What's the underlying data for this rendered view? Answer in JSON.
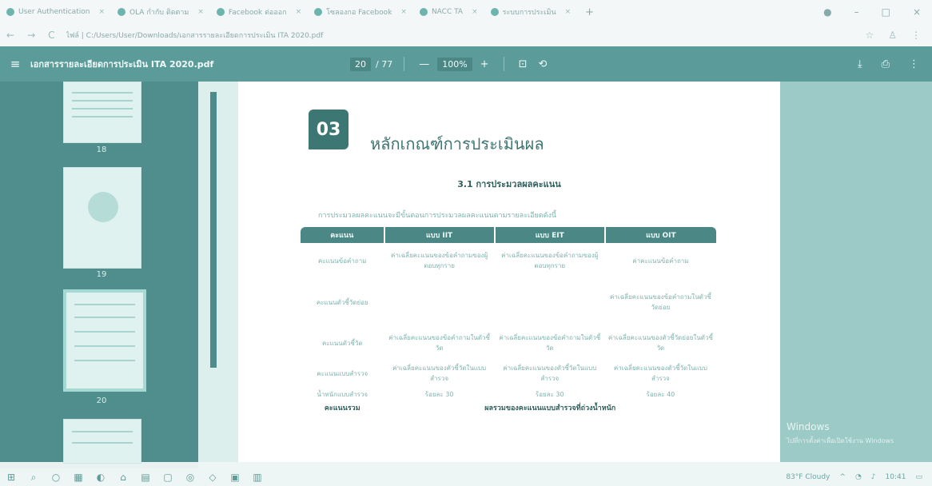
{
  "tabs": [
    {
      "label": "User Authentication"
    },
    {
      "label": "OLA กำกับ ติดตาม"
    },
    {
      "label": "Facebook ต่อออก"
    },
    {
      "label": "โซลองกอ Facebook"
    },
    {
      "label": "NACC TA"
    },
    {
      "label": "ระบบการประเมิน"
    }
  ],
  "address": {
    "url": "ไฟล์ | C:/Users/User/Downloads/เอกสารรายละเอียดการประเมิน ITA 2020.pdf"
  },
  "pdf": {
    "filename": "เอกสารรายละเอียดการประเมิน ITA 2020.pdf",
    "page": "20",
    "total": "/ 77",
    "zoom": "100%",
    "minus": "—",
    "plus": "+"
  },
  "thumbnails": [
    {
      "label": "18"
    },
    {
      "label": "19"
    },
    {
      "label": "20"
    }
  ],
  "doc": {
    "badge": "03",
    "section_title": "หลักเกณฑ์การประเมินผล",
    "subsection": "3.1 การประมวลผลคะแนน",
    "intro": "การประมวลผลคะแนนจะมีขั้นตอนการประมวลผลคะแนนตามรายละเอียดดังนี้",
    "table": {
      "headers": [
        "คะแนน",
        "แบบ IIT",
        "แบบ EIT",
        "แบบ OIT"
      ],
      "rows": [
        [
          "คะแนนข้อคำถาม",
          "ค่าเฉลี่ยคะแนนของข้อคำถามของผู้ตอบทุกราย",
          "ค่าเฉลี่ยคะแนนของข้อคำถามของผู้ตอบทุกราย",
          "ค่าคะแนนข้อคำถาม"
        ],
        [
          "คะแนนตัวชี้วัดย่อย",
          "",
          "",
          "ค่าเฉลี่ยคะแนนของข้อคำถามในตัวชี้วัดย่อย"
        ],
        [
          "คะแนนตัวชี้วัด",
          "ค่าเฉลี่ยคะแนนของข้อคำถามในตัวชี้วัด",
          "ค่าเฉลี่ยคะแนนของข้อคำถามในตัวชี้วัด",
          "ค่าเฉลี่ยคะแนนของตัวชี้วัดย่อยในตัวชี้วัด"
        ],
        [
          "คะแนนแบบสำรวจ",
          "ค่าเฉลี่ยคะแนนของตัวชี้วัดในแบบสำรวจ",
          "ค่าเฉลี่ยคะแนนของตัวชี้วัดในแบบสำรวจ",
          "ค่าเฉลี่ยคะแนนของตัวชี้วัดในแบบสำรวจ"
        ],
        [
          "น้ำหนักแบบสำรวจ",
          "ร้อยละ 30",
          "ร้อยละ 30",
          "ร้อยละ 40"
        ]
      ],
      "total_label": "คะแนนรวม",
      "total_value": "ผลรวมของคะแนนแบบสำรวจที่ถ่วงน้ำหนัก"
    }
  },
  "watermark": {
    "line1": "Windows",
    "line2": "ไปที่การตั้งค่าเพื่อเปิดใช้งาน Windows"
  },
  "taskbar": {
    "weather": "83°F Cloudy",
    "time": "10:41"
  }
}
